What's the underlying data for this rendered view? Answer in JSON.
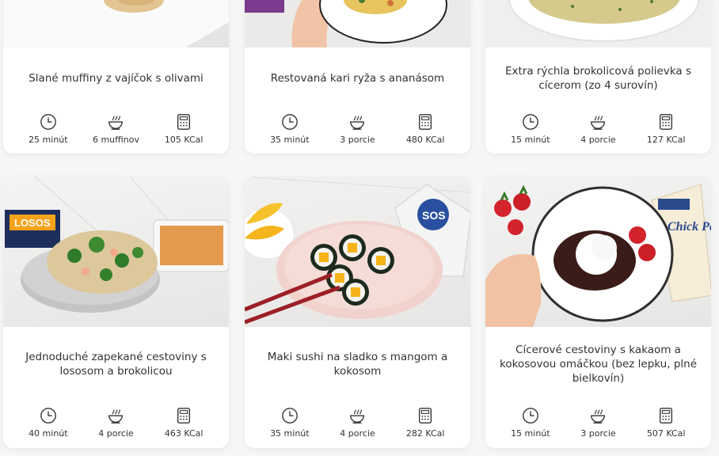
{
  "recipes": [
    {
      "title": "Slané muffiny z vajíčok s olivami",
      "time": "25 minút",
      "portions": "6 muffinov",
      "kcal": "105 KCal"
    },
    {
      "title": "Restovaná kari ryža s ananásom",
      "time": "35 minút",
      "portions": "3 porcie",
      "kcal": "480 KCal"
    },
    {
      "title": "Extra rýchla brokolicová polievka s cícerom (zo 4 surovín)",
      "time": "15 minút",
      "portions": "4 porcie",
      "kcal": "127 KCal"
    },
    {
      "title": "Jednoduché zapekané cestoviny s lososom a brokolicou",
      "time": "40 minút",
      "portions": "4 porcie",
      "kcal": "463 KCal",
      "label_text": "LOSOS"
    },
    {
      "title": "Maki sushi na sladko s mangom a kokosom",
      "time": "35 minút",
      "portions": "4 porcie",
      "kcal": "282 KCal",
      "label_text": "SOS"
    },
    {
      "title": "Cícerové cestoviny s kakaom a kokosovou omáčkou (bez lepku, plné bielkovín)",
      "time": "15 minút",
      "portions": "3 porcie",
      "kcal": "507 KCal",
      "label_text": "Chick Pea"
    }
  ],
  "icons": {
    "time": "clock-icon",
    "portions": "bowl-icon",
    "kcal": "calculator-icon"
  },
  "colors": {
    "background": "#f6f6f6",
    "card": "#ffffff",
    "text": "#333333"
  }
}
